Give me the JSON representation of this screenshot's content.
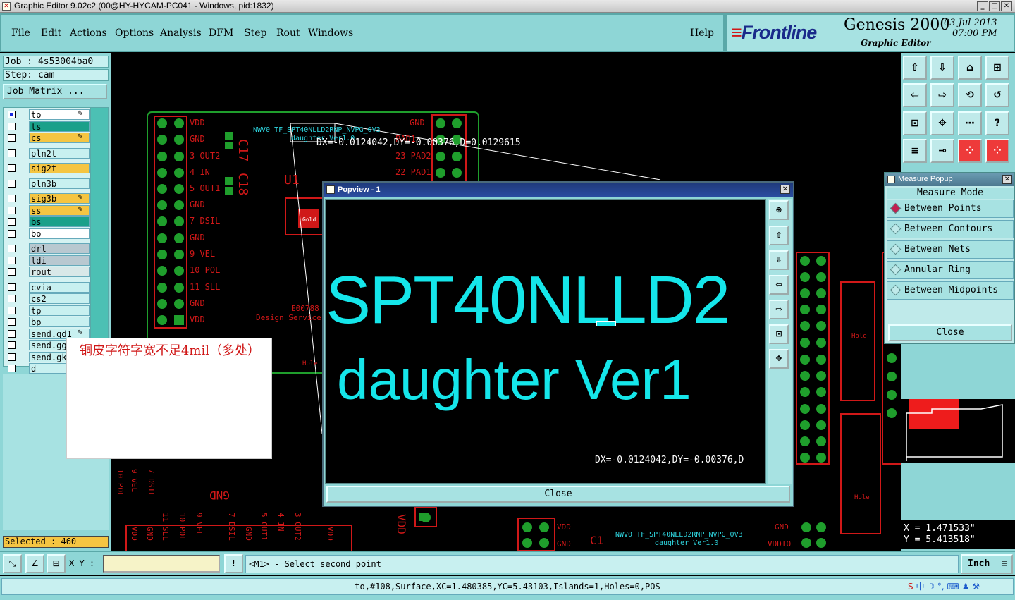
{
  "window": {
    "title": "Graphic Editor 9.02c2 (00@HY-HYCAM-PC041 - Windows, pid:1832)",
    "min": "_",
    "max": "□",
    "close": "✕"
  },
  "menu": {
    "items": [
      "File",
      "Edit",
      "Actions",
      "Options",
      "Analysis",
      "DFM",
      "Step",
      "Rout",
      "Windows"
    ],
    "help": "Help"
  },
  "brand": {
    "logo": "Frontline",
    "product": "Genesis 2000",
    "subtitle": "Graphic Editor",
    "date": "03 Jul 2013",
    "time": "07:00 PM"
  },
  "left": {
    "job": "Job : 4s53004ba0",
    "step": "Step: cam",
    "job_matrix": "Job Matrix ...",
    "selected": "Selected : 460",
    "layers": [
      {
        "name": "to",
        "color": "#ffffff",
        "checked": true,
        "edit": true
      },
      {
        "name": "ts",
        "color": "#1aa08a",
        "checked": false,
        "edit": false
      },
      {
        "name": "cs",
        "color": "#f5c542",
        "checked": false,
        "edit": true
      },
      {
        "name": "pln2t",
        "color": "#c8f0f0",
        "checked": false,
        "edit": false
      },
      {
        "name": "sig2t",
        "color": "#f5c542",
        "checked": false,
        "edit": false
      },
      {
        "name": "pln3b",
        "color": "#c8f0f0",
        "checked": false,
        "edit": false
      },
      {
        "name": "sig3b",
        "color": "#f5c542",
        "checked": false,
        "edit": true
      },
      {
        "name": "ss",
        "color": "#f5c542",
        "checked": false,
        "edit": true
      },
      {
        "name": "bs",
        "color": "#1aa08a",
        "checked": false,
        "edit": false
      },
      {
        "name": "bo",
        "color": "#ffffff",
        "checked": false,
        "edit": false
      },
      {
        "name": "drl",
        "color": "#b8c8d0",
        "checked": false,
        "edit": false
      },
      {
        "name": "ldi",
        "color": "#b8c8d0",
        "checked": false,
        "edit": false
      },
      {
        "name": "rout",
        "color": "#d8e8e8",
        "checked": false,
        "edit": false
      },
      {
        "name": "cvia",
        "color": "#c8f0f0",
        "checked": false,
        "edit": false
      },
      {
        "name": "cs2",
        "color": "#c8f0f0",
        "checked": false,
        "edit": false
      },
      {
        "name": "tp",
        "color": "#c8f0f0",
        "checked": false,
        "edit": false
      },
      {
        "name": "bp",
        "color": "#c8f0f0",
        "checked": false,
        "edit": false
      },
      {
        "name": "send.gd1",
        "color": "#c8f0f0",
        "checked": false,
        "edit": true
      },
      {
        "name": "send.gg1",
        "color": "#c8f0f0",
        "checked": false,
        "edit": false
      },
      {
        "name": "send.gko",
        "color": "#c8f0f0",
        "checked": false,
        "edit": false
      },
      {
        "name": "d",
        "color": "#c8f0f0",
        "checked": false,
        "edit": false
      }
    ]
  },
  "canvas": {
    "measure_readout": "DX=-0.0124042,DY=-0.00376,D=0.0129615",
    "pins_left": [
      "VDD",
      "GND",
      "3 OUT2",
      "4 IN",
      "5 OUT1",
      "GND",
      "7 DSIL",
      "GND",
      "9 VEL",
      "10 POL",
      "11 SLL",
      "GND",
      "VDD"
    ],
    "pins_right": [
      "GND",
      "PAD1",
      "23 PAD2",
      "22 PAD1"
    ],
    "silk_top": "NWV0 TF_SPT40NLLD2RNP_NVPG_0V3",
    "silk_top2": "daughter Ver1.0",
    "u1": "U1",
    "c17": "C17",
    "c18": "C18",
    "gold": "Gold",
    "hole": "Hole",
    "design": "Design Service",
    "e00": "E00788",
    "gnd_big": "GND",
    "vdd_vert": "VDD",
    "c1": "C1",
    "silk_bottom": "NWV0 TF_SPT40NLLD2RNP_NVPG_0V3",
    "silk_bottom2": "daughter Ver1.0",
    "vddio": "VDDIO",
    "bottom_vert": [
      "VDD",
      "GND",
      "11 SLL",
      "10 POL",
      "9 VEL",
      "7 DSIL",
      "GND",
      "5 OUT1",
      "4 IN",
      "3 OUT2",
      "VDD"
    ],
    "rot_labels": [
      "10 POL",
      "9 VEL",
      "7 DSIL"
    ]
  },
  "popview": {
    "title": "Popview - 1",
    "line1": "SPT40NLLD2",
    "line2": "daughter Ver1",
    "readout": "DX=-0.0124042,DY=-0.00376,D",
    "close": "Close"
  },
  "measure": {
    "title": "Measure Popup",
    "mode_label": "Measure Mode",
    "options": [
      "Between Points",
      "Between Contours",
      "Between Nets",
      "Annular Ring",
      "Between Midpoints"
    ],
    "selected_index": 0,
    "close": "Close"
  },
  "coords": {
    "x": "X = 1.471533\"",
    "y": "Y = 5.413518\""
  },
  "annotation": "铜皮字符字宽不足4mil（多处）",
  "cmd": {
    "xy_label": "X Y :",
    "xy_value": "",
    "excl": "!",
    "prompt": "<M1> - Select second point",
    "unit": "Inch"
  },
  "status": "to,#108,Surface,XC=1.480385,YC=5.43103,Islands=1,Holes=0,POS",
  "ime": "中",
  "colors": {
    "teal": "#8ed6d6",
    "pcb_red": "#d01818",
    "pad_green": "#1f9e2c",
    "silk_cyan": "#15e6ea"
  }
}
